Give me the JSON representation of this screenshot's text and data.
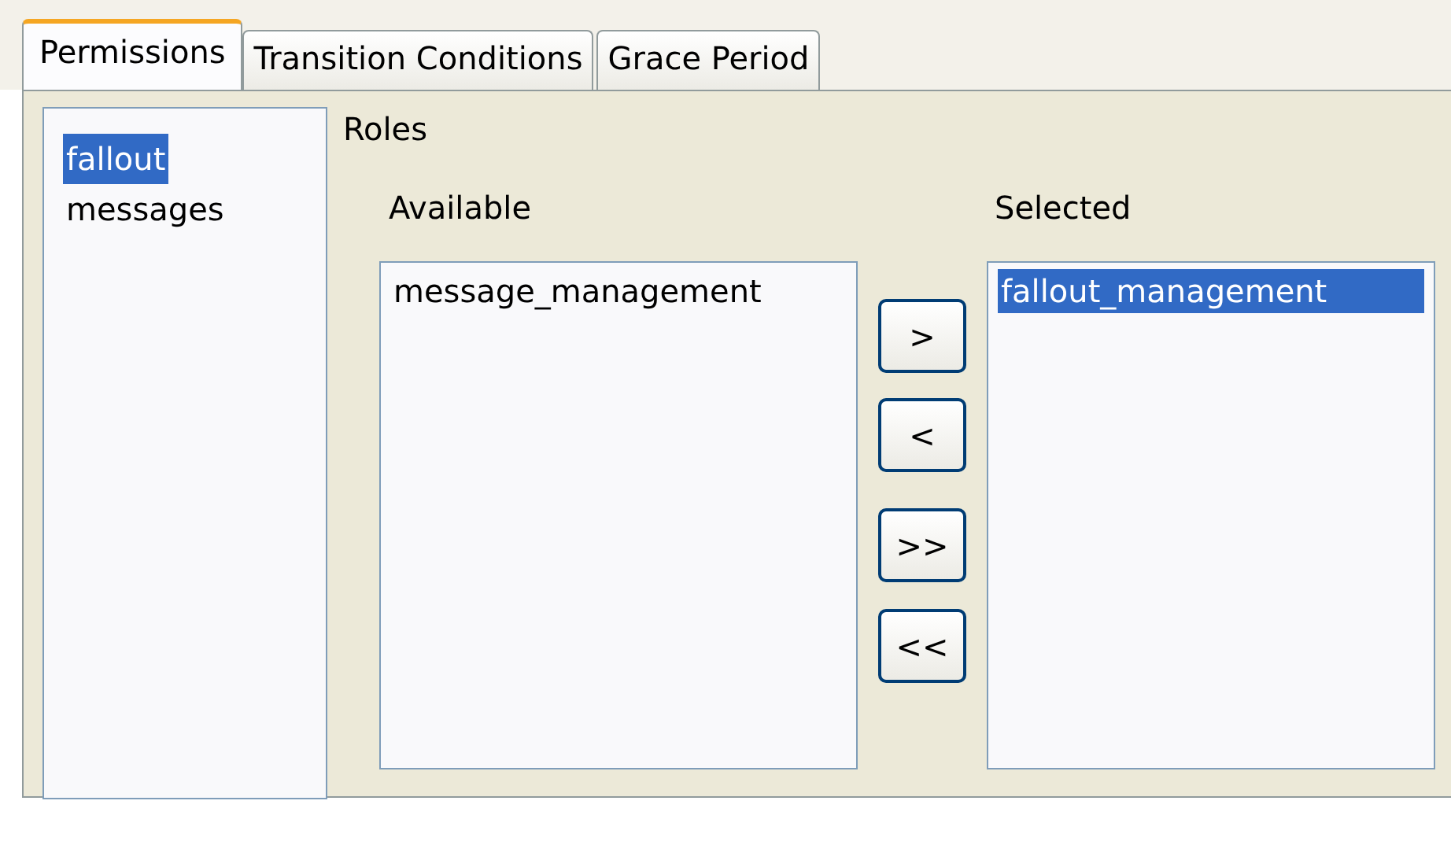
{
  "tabs": [
    {
      "label": "Permissions",
      "selected": true
    },
    {
      "label": "Transition Conditions",
      "selected": false
    },
    {
      "label": "Grace Period",
      "selected": false
    }
  ],
  "sidebar": {
    "items": [
      {
        "label": "fallout",
        "selected": true
      },
      {
        "label": "messages",
        "selected": false
      }
    ]
  },
  "roles": {
    "title": "Roles",
    "available": {
      "label": "Available",
      "items": [
        {
          "label": "message_management",
          "selected": false
        }
      ]
    },
    "buttons": [
      ">",
      "<",
      ">>",
      "<<"
    ],
    "selected": {
      "label": "Selected",
      "items": [
        {
          "label": "fallout_management",
          "selected": true
        }
      ]
    }
  }
}
